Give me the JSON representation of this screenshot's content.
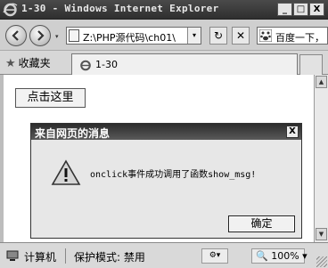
{
  "window": {
    "title": "1-30 - Windows Internet Explorer",
    "buttons": {
      "minimize": "_",
      "maximize": "□",
      "close": "X"
    }
  },
  "nav": {
    "address": "Z:\\PHP源代码\\ch01\\",
    "search_text": "百度一下，",
    "dropdown_glyph": "▾",
    "refresh_glyph": "↻",
    "stop_glyph": "✕"
  },
  "favorites": {
    "label": "收藏夹",
    "tab_label": "1-30"
  },
  "page": {
    "button_label": "点击这里"
  },
  "dialog": {
    "title": "来自网页的消息",
    "message": "onclick事件成功调用了函数show_msg!",
    "ok_label": "确定",
    "close_glyph": "X"
  },
  "status": {
    "zone": "计算机",
    "protected_mode": "保护模式: 禁用",
    "zoom": "100%",
    "zoom_icon": "🔍"
  }
}
